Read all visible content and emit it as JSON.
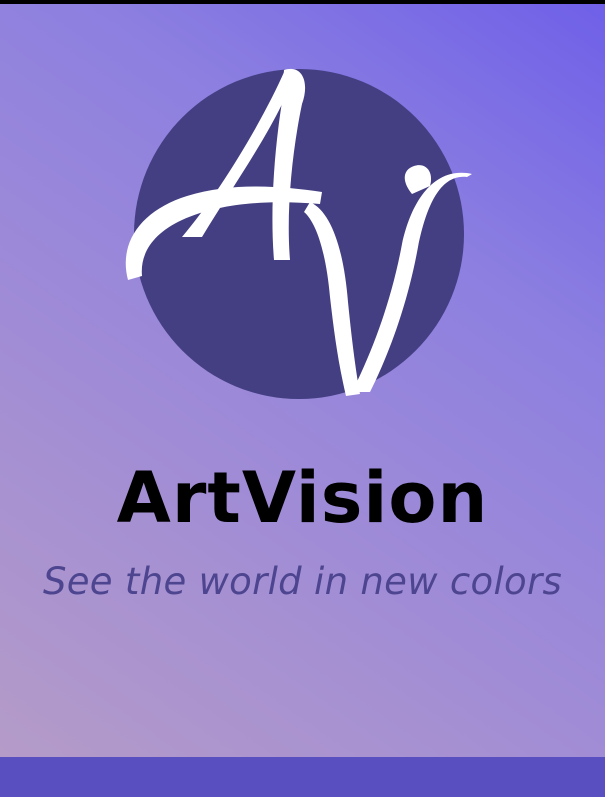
{
  "app": {
    "name": "ArtVision",
    "tagline": "See the world in new colors",
    "logo_monogram": "AV"
  },
  "colors": {
    "gradient_top_right": "#6f60e8",
    "gradient_bottom_left": "#b49bc8",
    "logo_circle": "#433f82",
    "logo_letters": "#ffffff",
    "title_text": "#000000",
    "tagline_text": "#4d458f",
    "bottom_bar": "#5a4fc0"
  }
}
